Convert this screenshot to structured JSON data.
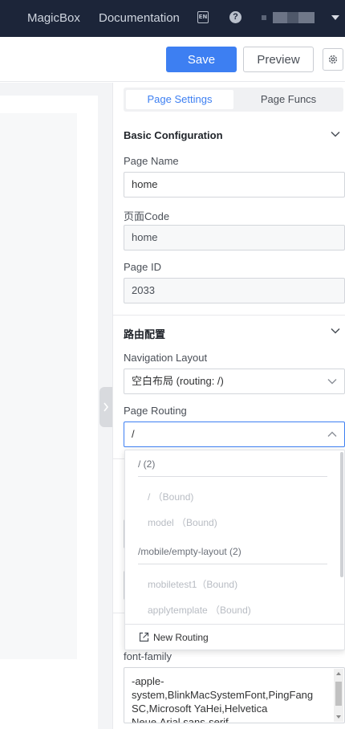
{
  "nav": {
    "links": [
      "MagicBox",
      "Documentation"
    ],
    "lang_badge": "EN",
    "help_glyph": "?",
    "icons": [
      "language-icon",
      "help-icon",
      "user-dropdown-caret-icon"
    ]
  },
  "toolbar": {
    "save_label": "Save",
    "preview_label": "Preview",
    "settings_icon": "gear-icon"
  },
  "panel": {
    "tabs": [
      {
        "label": "Page Settings",
        "active": true
      },
      {
        "label": "Page Funcs",
        "active": false
      }
    ],
    "basic": {
      "title": "Basic Configuration",
      "page_name_label": "Page Name",
      "page_name_value": "home",
      "page_code_label": "页面Code",
      "page_code_value": "home",
      "page_id_label": "Page ID",
      "page_id_value": "2033"
    },
    "routing": {
      "title": "路由配置",
      "nav_layout_label": "Navigation Layout",
      "nav_layout_value": "空白布局 (routing: /)",
      "page_routing_label": "Page Routing",
      "page_routing_value": "/"
    },
    "style": {
      "font_family_label": "font-family",
      "font_family_value": "-apple-system,BlinkMacSystemFont,PingFang SC,Microsoft YaHei,Helvetica Neue,Arial,sans-serif"
    }
  },
  "dropdown": {
    "groups": [
      {
        "header": "/ (2)",
        "items": [
          "/ （Bound)",
          "model （Bound)"
        ]
      },
      {
        "header": "/mobile/empty-layout (2)",
        "items": [
          "mobiletest1（Bound)",
          "applytemplate （Bound)"
        ]
      }
    ],
    "new_routing_label": "New Routing",
    "new_routing_icon": "external-link-icon"
  },
  "colors": {
    "nav_bg": "#1c2539",
    "primary": "#3d7ff2",
    "text": "#313233",
    "disabled_text": "#b8bcc3"
  }
}
